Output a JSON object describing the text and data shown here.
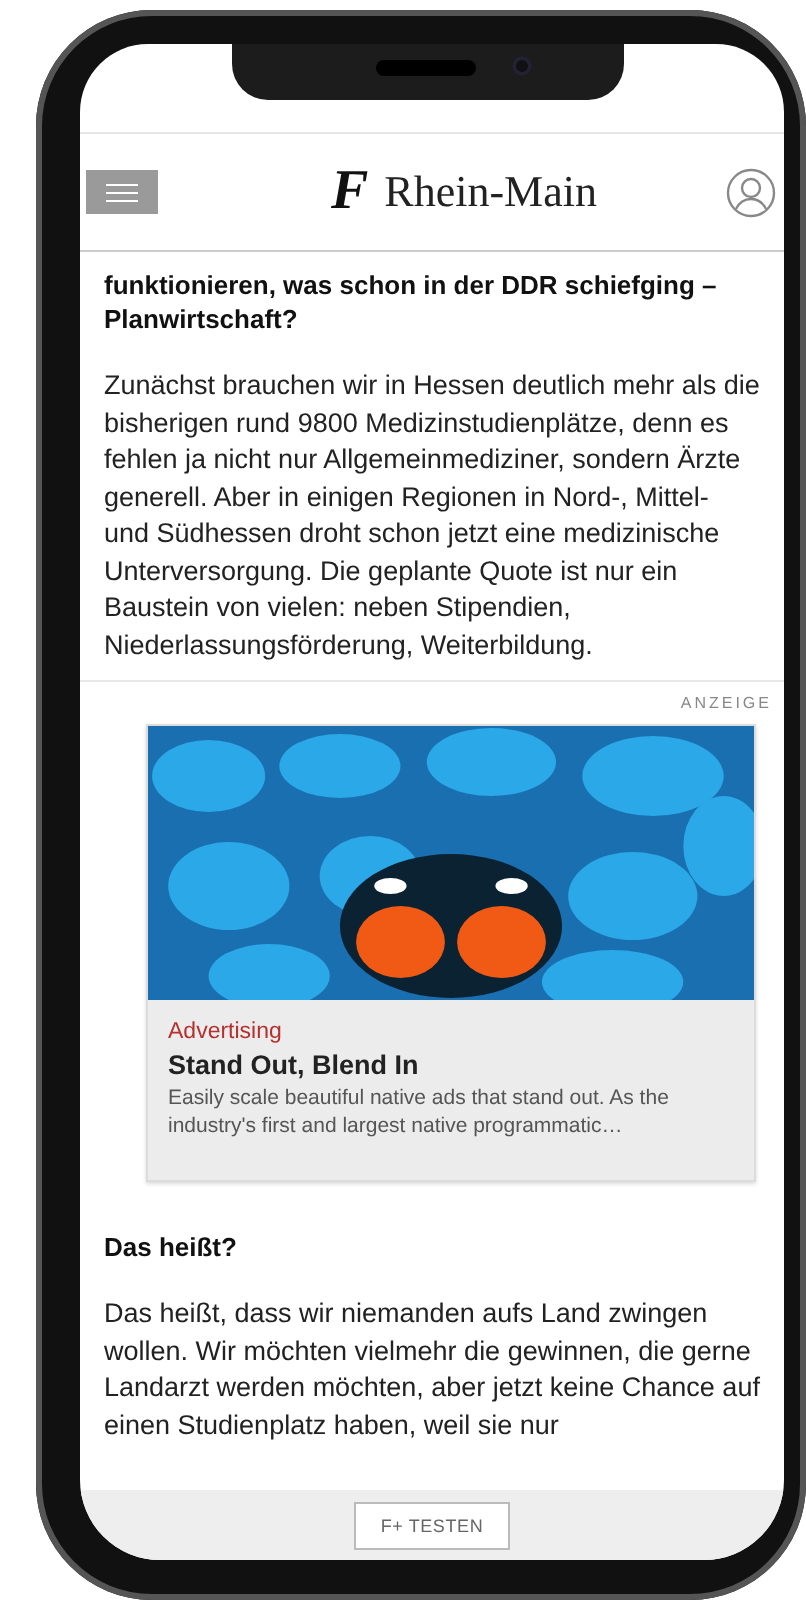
{
  "header": {
    "logo_letter": "F",
    "title": "Rhein-Main"
  },
  "sections": [
    {
      "heading": "funktionieren, was schon in der DDR schiefging – Planwirtschaft?",
      "paragraph": "Zunächst brauchen wir in Hessen deutlich mehr als die bisherigen rund 9800 Medizinstudienplätze, denn es fehlen ja nicht nur Allgemeinmediziner, sondern Ärzte generell. Aber in einigen Regionen in Nord-, Mittel- und Südhessen droht schon jetzt eine medizinische Unterversorgung. Die geplante Quote ist nur ein Baustein von vielen: neben Stipendien, Niederlassungsförderung, Weiterbildung."
    },
    {
      "heading": "Das heißt?",
      "paragraph": "Das heißt, dass wir niemanden aufs Land zwingen wollen. Wir möchten vielmehr die gewinnen, die gerne Landarzt werden möchten, aber jetzt keine Chance auf einen Studienplatz haben, weil sie nur"
    }
  ],
  "ad": {
    "label": "ANZEIGE",
    "category": "Advertising",
    "title": "Stand Out, Blend In",
    "description": "Easily scale beautiful native ads that stand out. As the industry's first and largest native programmatic…"
  },
  "bottom_bar": {
    "button": "F+ TESTEN"
  }
}
